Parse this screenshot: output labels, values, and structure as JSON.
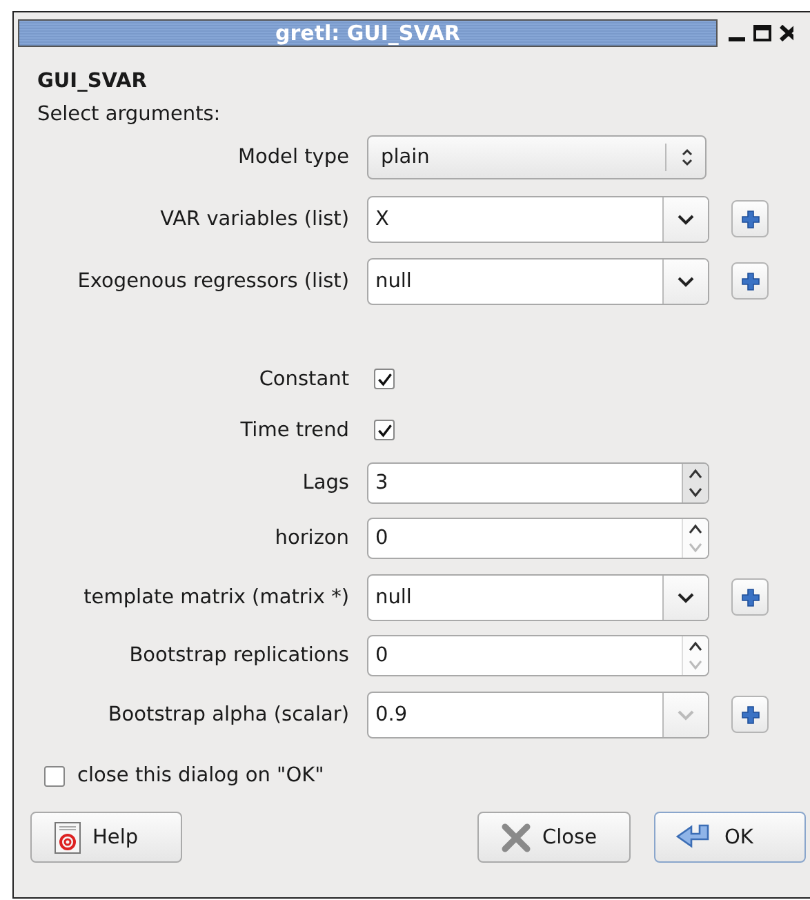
{
  "window": {
    "title": "gretl: GUI_SVAR"
  },
  "heading": "GUI_SVAR",
  "prompt": "Select arguments:",
  "arguments": [
    {
      "kind": "combo",
      "label": "Model type",
      "value": "plain"
    },
    {
      "kind": "dropdown",
      "label": "VAR variables (list)",
      "value": "X",
      "arrow_disabled": false
    },
    {
      "kind": "dropdown",
      "label": "Exogenous regressors (list)",
      "value": "null",
      "arrow_disabled": false
    },
    {
      "kind": "check",
      "label": "Constant",
      "checked": true
    },
    {
      "kind": "check",
      "label": "Time trend",
      "checked": true
    },
    {
      "kind": "spin",
      "label": "Lags",
      "value": "3",
      "down_disabled": false
    },
    {
      "kind": "spin",
      "label": "horizon",
      "value": "0",
      "down_disabled": true
    },
    {
      "kind": "dropdown",
      "label": "template matrix (matrix *)",
      "value": "null",
      "arrow_disabled": false
    },
    {
      "kind": "spin",
      "label": "Bootstrap replications",
      "value": "0",
      "down_disabled": true
    },
    {
      "kind": "dropdown",
      "label": "Bootstrap alpha (scalar)",
      "value": "0.9",
      "arrow_disabled": true
    }
  ],
  "close_on_ok": {
    "label": "close this dialog on \"OK\"",
    "checked": false
  },
  "buttons": [
    {
      "kind": "help",
      "label": "Help"
    },
    {
      "kind": "close",
      "label": "Close"
    },
    {
      "kind": "ok",
      "label": "OK"
    }
  ]
}
